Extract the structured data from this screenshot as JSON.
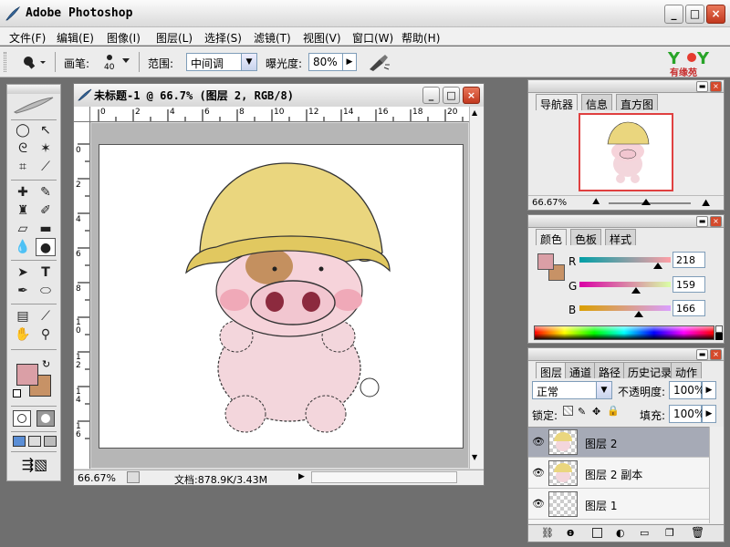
{
  "app": {
    "title": "Adobe Photoshop"
  },
  "window_controls": {
    "minimize": "_",
    "maximize": "□",
    "close": "×"
  },
  "menu": [
    "文件(F)",
    "编辑(E)",
    "图像(I)",
    "图层(L)",
    "选择(S)",
    "滤镜(T)",
    "视图(V)",
    "窗口(W)",
    "帮助(H)"
  ],
  "options": {
    "brush_label": "画笔:",
    "brush_size": "40",
    "range_label": "范围:",
    "range_value": "中间调",
    "exposure_label": "曝光度:",
    "exposure_value": "80%",
    "logo_text": "有缘苑"
  },
  "document": {
    "title": "未标题-1 @ 66.7% (图层 2, RGB/8)",
    "zoom": "66.67%",
    "doc_info": "文档:878.9K/3.43M",
    "ruler_h": [
      "0",
      "2",
      "4",
      "6",
      "8",
      "10",
      "12",
      "14",
      "16",
      "18",
      "20"
    ],
    "ruler_v": [
      "0",
      "2",
      "4",
      "6",
      "8",
      "1 0",
      "1 2",
      "1 4",
      "1 6"
    ]
  },
  "navigator": {
    "tabs": [
      "导航器",
      "信息",
      "直方图"
    ],
    "zoom": "66.67%"
  },
  "color": {
    "tabs": [
      "颜色",
      "色板",
      "样式"
    ],
    "channels": [
      {
        "label": "R",
        "value": "218",
        "level": 0.855
      },
      {
        "label": "G",
        "value": "159",
        "level": 0.624
      },
      {
        "label": "B",
        "value": "166",
        "level": 0.651
      }
    ],
    "foreground": "#da9fa6",
    "background": "#c79266"
  },
  "layers": {
    "tabs": [
      "图层",
      "通道",
      "路径",
      "历史记录",
      "动作"
    ],
    "blend_mode": "正常",
    "opacity_label": "不透明度:",
    "opacity": "100%",
    "lock_label": "锁定:",
    "fill_label": "填充:",
    "fill": "100%",
    "items": [
      {
        "name": "图层 2",
        "selected": true
      },
      {
        "name": "图层 2 副本",
        "selected": false
      },
      {
        "name": "图层 1",
        "selected": false
      }
    ]
  },
  "colors": {
    "accent": "#c2381e",
    "selection_blue": "#316ac5"
  }
}
